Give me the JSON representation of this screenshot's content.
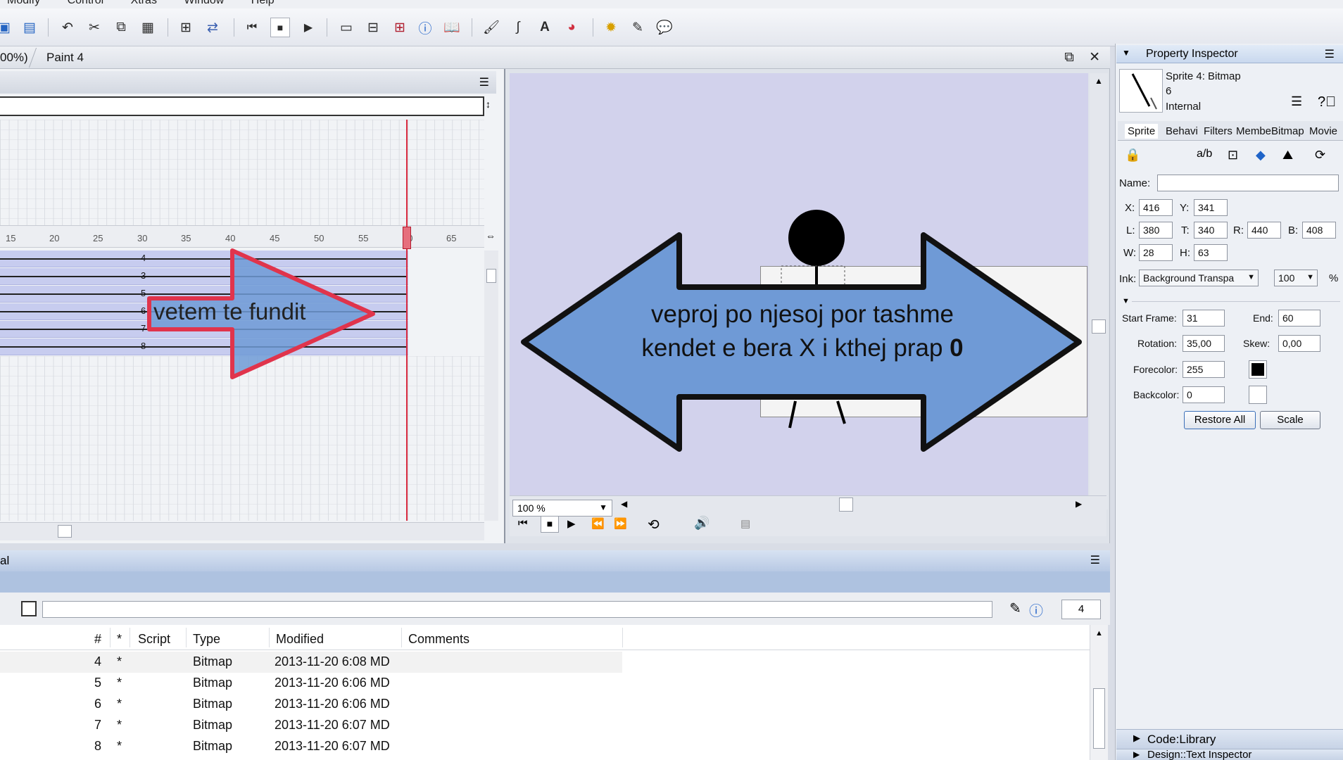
{
  "menubar": {
    "items": [
      "Modify",
      "Control",
      "Xtras",
      "Window",
      "Help"
    ]
  },
  "toolbar": {
    "icons": [
      "save-icon",
      "save-all-icon",
      "undo-icon",
      "cut-icon",
      "copy-icon",
      "paste-icon",
      "find-icon",
      "exchange-icon",
      "rewind-icon",
      "stop-icon",
      "play-icon",
      "stage-icon",
      "score-icon",
      "cast-icon",
      "info-icon",
      "book-icon",
      "brush-icon",
      "line-icon",
      "text-icon",
      "color-icon",
      "gear-icon",
      "script-icon",
      "chat-icon"
    ]
  },
  "score": {
    "tabs": [
      "00%)",
      "Paint 4"
    ],
    "ruler": [
      "15",
      "20",
      "25",
      "30",
      "35",
      "40",
      "45",
      "50",
      "55",
      "60",
      "65"
    ],
    "channels": [
      "4",
      "3",
      "5",
      "6",
      "7",
      "8"
    ]
  },
  "annotations": {
    "score_arrow": "vetem te fundit",
    "stage_arrow_line1": "veproj po njesoj por tashme",
    "stage_arrow_line2": "kendet e bera X i kthej prap",
    "stage_arrow_bold": "0"
  },
  "stage": {
    "zoom": "100 %"
  },
  "property_inspector": {
    "title": "Property Inspector",
    "sprite_title": "Sprite 4: Bitmap",
    "sprite_num": "6",
    "sprite_cast": "Internal",
    "tabs": [
      "Sprite",
      "Behavi",
      "Filters",
      "Membe",
      "Bitmap",
      "Movie"
    ],
    "name_label": "Name:",
    "name_value": "",
    "x_label": "X:",
    "x": "416",
    "y_label": "Y:",
    "y": "341",
    "l_label": "L:",
    "l": "380",
    "t_label": "T:",
    "t": "340",
    "r_label": "R:",
    "r": "440",
    "b_label": "B:",
    "b": "408",
    "w_label": "W:",
    "w": "28",
    "h_label": "H:",
    "h": "63",
    "ink_label": "Ink:",
    "ink": "Background Transpa",
    "blend": "100",
    "blend_unit": "%",
    "start_label": "Start Frame:",
    "start": "31",
    "end_label": "End:",
    "end": "60",
    "rotation_label": "Rotation:",
    "rotation": "35,00",
    "skew_label": "Skew:",
    "skew": "0,00",
    "forecolor_label": "Forecolor:",
    "forecolor": "255",
    "backcolor_label": "Backcolor:",
    "backcolor": "0",
    "restore_btn": "Restore All",
    "scale_btn": "Scale"
  },
  "cast": {
    "title": "al",
    "count": "4",
    "columns": [
      "#",
      "*",
      "Script",
      "Type",
      "Modified",
      "Comments"
    ],
    "rows": [
      {
        "num": "4",
        "star": "*",
        "type": "Bitmap",
        "modified": "2013-11-20 6:08 MD"
      },
      {
        "num": "5",
        "star": "*",
        "type": "Bitmap",
        "modified": "2013-11-20 6:06 MD"
      },
      {
        "num": "6",
        "star": "*",
        "type": "Bitmap",
        "modified": "2013-11-20 6:06 MD"
      },
      {
        "num": "7",
        "star": "*",
        "type": "Bitmap",
        "modified": "2013-11-20 6:07 MD"
      },
      {
        "num": "8",
        "star": "*",
        "type": "Bitmap",
        "modified": "2013-11-20 6:07 MD"
      }
    ]
  },
  "panels": {
    "code_library": "Code:Library",
    "design": "Design::Text Inspector"
  },
  "colors": {
    "arrow_blue": "#6f9ad6",
    "arrow_red": "#e0344c",
    "stage_bg": "#d2d2ec",
    "playhead": "#d92b40"
  }
}
